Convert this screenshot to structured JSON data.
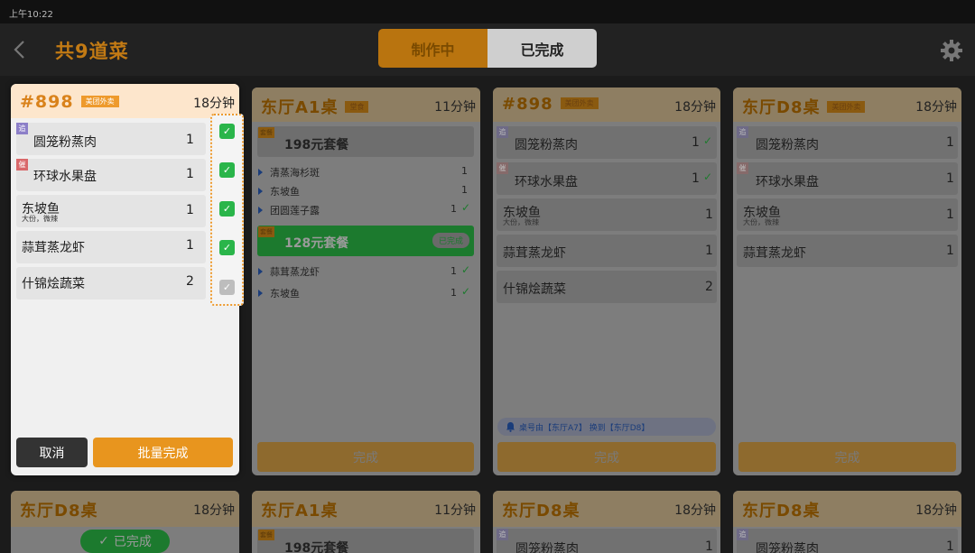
{
  "status": {
    "time": "上午10:22"
  },
  "header": {
    "title": "共9道菜",
    "tabs": [
      "制作中",
      "已完成"
    ]
  },
  "colors": {
    "accent": "#e8951e",
    "checked": "#2ab54a",
    "unchecked": "#bdbdbd"
  },
  "icons": [
    "back-icon",
    "gear-icon",
    "check-icon",
    "bell-icon",
    "check-circle-icon"
  ],
  "active": {
    "title": "#898",
    "tag": "美团外卖",
    "time": "18分钟",
    "items": [
      {
        "name": "圆笼粉蒸肉",
        "qty": "1",
        "badge": "追",
        "checked": true
      },
      {
        "name": "环球水果盘",
        "qty": "1",
        "badge": "催",
        "checked": true
      },
      {
        "name": "东坡鱼",
        "sub": "大份，微辣",
        "qty": "1",
        "checked": true
      },
      {
        "name": "蒜茸蒸龙虾",
        "qty": "1",
        "checked": true
      },
      {
        "name": "什锦烩蔬菜",
        "qty": "2",
        "checked": false
      }
    ],
    "cancel": "取消",
    "batch": "批量完成"
  },
  "card2": {
    "title": "东厅A1桌",
    "tag": "堂食",
    "time": "11分钟",
    "set1": {
      "badge": "套餐",
      "name": "198元套餐",
      "items": [
        {
          "name": "清蒸海杉斑",
          "qty": "1"
        },
        {
          "name": "东坡鱼",
          "qty": "1"
        },
        {
          "name": "团圆莲子露",
          "qty": "1"
        }
      ]
    },
    "set2": {
      "badge": "套餐",
      "name": "128元套餐",
      "status": "已完成",
      "items": [
        {
          "name": "蒜茸蒸龙虾",
          "qty": "1"
        },
        {
          "name": "东坡鱼",
          "qty": "1"
        }
      ]
    },
    "done": "完成"
  },
  "card3": {
    "title": "#898",
    "tag": "美团外卖",
    "time": "18分钟",
    "items": [
      {
        "name": "圆笼粉蒸肉",
        "qty": "1",
        "badge": "追"
      },
      {
        "name": "环球水果盘",
        "qty": "1",
        "badge": "催"
      },
      {
        "name": "东坡鱼",
        "sub": "大份，微辣",
        "qty": "1"
      },
      {
        "name": "蒜茸蒸龙虾",
        "qty": "1"
      },
      {
        "name": "什锦烩蔬菜",
        "qty": "2"
      }
    ],
    "notice": "桌号由【东厅A7】 换到【东厅D8】",
    "done": "完成"
  },
  "card4": {
    "title": "东厅D8桌",
    "tag": "美团外卖",
    "time": "18分钟",
    "items": [
      {
        "name": "圆笼粉蒸肉",
        "qty": "1",
        "badge": "追"
      },
      {
        "name": "环球水果盘",
        "qty": "1",
        "badge": "催"
      },
      {
        "name": "东坡鱼",
        "sub": "大份，微辣",
        "qty": "1"
      },
      {
        "name": "蒜茸蒸龙虾",
        "qty": "1"
      }
    ],
    "done": "完成"
  },
  "bottom": [
    {
      "title": "东厅D8桌",
      "time": "18分钟",
      "status": "已完成"
    },
    {
      "title": "东厅A1桌",
      "time": "11分钟",
      "set_badge": "套餐",
      "set_name": "198元套餐"
    },
    {
      "title": "东厅D8桌",
      "time": "18分钟",
      "item": "圆笼粉蒸肉",
      "qty": "1",
      "badge": "追"
    },
    {
      "title": "东厅D8桌",
      "time": "18分钟",
      "item": "圆笼粉蒸肉",
      "qty": "1",
      "badge": "追"
    }
  ]
}
